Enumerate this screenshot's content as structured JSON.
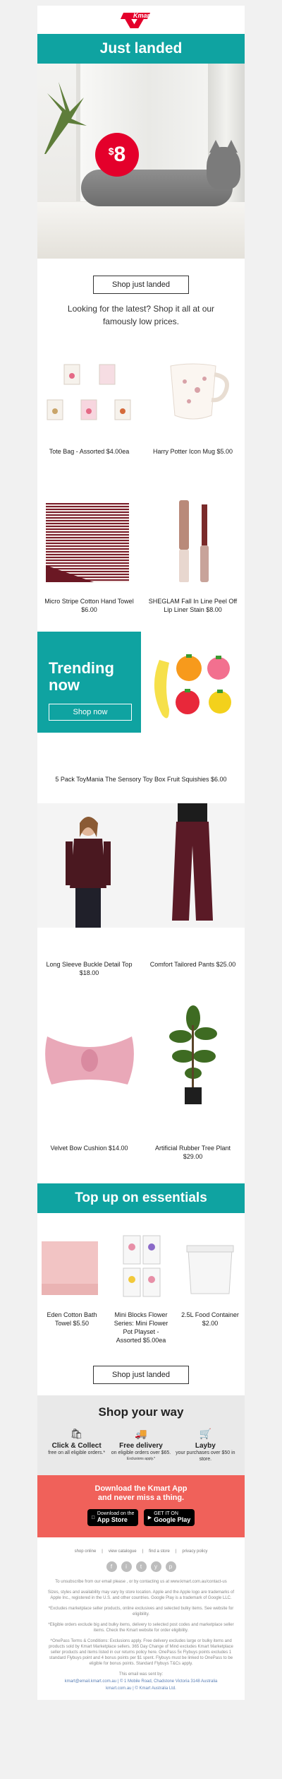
{
  "brand": {
    "name": "Kmart",
    "accent": "#e4002b",
    "teal": "#0fa3a1"
  },
  "hero": {
    "heading": "Just landed",
    "price_symbol": "$",
    "price": "8",
    "button": "Shop just landed"
  },
  "intro": "Looking for the latest? Shop it all at our famously low prices.",
  "products_a": [
    {
      "caption": "Tote Bag - Assorted $4.00ea"
    },
    {
      "caption": "Harry Potter Icon Mug $5.00"
    },
    {
      "caption": "Micro Stripe Cotton Hand Towel $6.00"
    },
    {
      "caption": "SHEGLAM Fall In Line Peel Off Lip Liner Stain $8.00"
    }
  ],
  "trending": {
    "heading": "Trending now",
    "button": "Shop now",
    "caption": "5 Pack ToyMania The Sensory Toy Box Fruit Squishies $6.00"
  },
  "products_b": [
    {
      "caption": "Long Sleeve Buckle Detail Top $18.00"
    },
    {
      "caption": "Comfort Tailored Pants $25.00"
    },
    {
      "caption": "Velvet Bow Cushion $14.00"
    },
    {
      "caption": "Artificial Rubber Tree Plant $29.00"
    }
  ],
  "essentials": {
    "heading": "Top up on essentials",
    "items": [
      {
        "caption": "Eden Cotton Bath Towel $5.50"
      },
      {
        "caption": "Mini Blocks Flower Series: Mini Flower Pot Playset - Assorted $5.00ea"
      },
      {
        "caption": "2.5L Food Container $2.00"
      }
    ],
    "button": "Shop just landed"
  },
  "shop_your_way": {
    "heading": "Shop your way",
    "options": [
      {
        "title": "Click & Collect",
        "sub": "free on all eligible orders.*"
      },
      {
        "title": "Free delivery",
        "sub": "on eligible orders over $65.",
        "small": "Exclusions apply.*"
      },
      {
        "title": "Layby",
        "sub": "your purchases over $50 in store."
      }
    ]
  },
  "app": {
    "line1": "Download the Kmart App",
    "line2": "and never miss a thing.",
    "appstore_small": "Download on the",
    "appstore": "App Store",
    "googleplay_small": "GET IT ON",
    "googleplay": "Google Play"
  },
  "footer": {
    "links": [
      "shop online",
      "view catalogue",
      "find a store",
      "privacy policy"
    ],
    "social": [
      "f",
      "i",
      "t",
      "y",
      "p"
    ],
    "para1": "To unsubscribe from our email please , or by contacting us at www.kmart.com.au/contact-us",
    "para2": "Sizes, styles and availability may vary by store location. Apple and the Apple logo are trademarks of Apple Inc., registered in the U.S. and other countries. Google Play is a trademark of Google LLC.",
    "para3": "*Excludes marketplace seller products, online exclusives and selected bulky items. See website for eligibility.",
    "para4": "*Eligible orders exclude big and bulky items, delivery to selected post codes and marketplace seller items. Check the Kmart website for order eligibility.",
    "para5": "^OnePass Terms & Conditions: Exclusions apply. Free delivery excludes large or bulky items and products sold by Kmart Marketplace sellers. 365 Day Change of Mind excludes Kmart Marketplace seller products and items listed in our returns policy here. OnePass 5x Flybuys points excludes 1 standard Flybuys point and 4 bonus points per $1 spent. Flybuys must be linked to OnePass to be eligible for bonus points. Standard Flybuys T&Cs apply.",
    "para6": "This email was sent by:",
    "para7": "kmart@email.kmart.com.au | © 1 Mobile Road, Chadstone Victoria 3148 Australia",
    "para8": "kmart.com.au | © Kmart Australia Ltd."
  }
}
